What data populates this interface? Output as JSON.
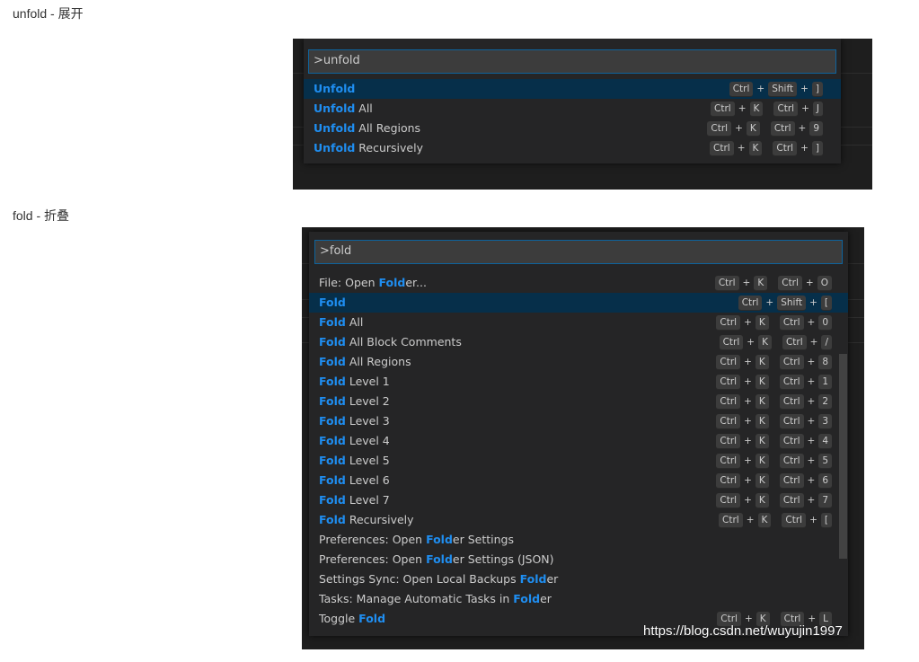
{
  "section1": {
    "caption": "unfold - 展开",
    "input_value": ">unfold",
    "items": [
      {
        "hl": "Unfold",
        "rest": "",
        "keys": [
          [
            "Ctrl",
            "Shift",
            "]"
          ]
        ],
        "selected": true
      },
      {
        "hl": "Unfold",
        "rest": " All",
        "keys": [
          [
            "Ctrl",
            "K"
          ],
          [
            "Ctrl",
            "J"
          ]
        ]
      },
      {
        "hl": "Unfold",
        "rest": " All Regions",
        "keys": [
          [
            "Ctrl",
            "K"
          ],
          [
            "Ctrl",
            "9"
          ]
        ]
      },
      {
        "hl": "Unfold",
        "rest": " Recursively",
        "keys": [
          [
            "Ctrl",
            "K"
          ],
          [
            "Ctrl",
            "]"
          ]
        ]
      }
    ]
  },
  "section2": {
    "caption": "fold - 折叠",
    "input_value": ">fold",
    "items": [
      {
        "pre": "File: Open ",
        "hl": "Fold",
        "rest": "er...",
        "keys": [
          [
            "Ctrl",
            "K"
          ],
          [
            "Ctrl",
            "O"
          ]
        ]
      },
      {
        "pre": "",
        "hl": "Fold",
        "rest": "",
        "keys": [
          [
            "Ctrl",
            "Shift",
            "["
          ]
        ],
        "selected": true
      },
      {
        "pre": "",
        "hl": "Fold",
        "rest": " All",
        "keys": [
          [
            "Ctrl",
            "K"
          ],
          [
            "Ctrl",
            "0"
          ]
        ]
      },
      {
        "pre": "",
        "hl": "Fold",
        "rest": " All Block Comments",
        "keys": [
          [
            "Ctrl",
            "K"
          ],
          [
            "Ctrl",
            "/"
          ]
        ]
      },
      {
        "pre": "",
        "hl": "Fold",
        "rest": " All Regions",
        "keys": [
          [
            "Ctrl",
            "K"
          ],
          [
            "Ctrl",
            "8"
          ]
        ]
      },
      {
        "pre": "",
        "hl": "Fold",
        "rest": " Level 1",
        "keys": [
          [
            "Ctrl",
            "K"
          ],
          [
            "Ctrl",
            "1"
          ]
        ]
      },
      {
        "pre": "",
        "hl": "Fold",
        "rest": " Level 2",
        "keys": [
          [
            "Ctrl",
            "K"
          ],
          [
            "Ctrl",
            "2"
          ]
        ]
      },
      {
        "pre": "",
        "hl": "Fold",
        "rest": " Level 3",
        "keys": [
          [
            "Ctrl",
            "K"
          ],
          [
            "Ctrl",
            "3"
          ]
        ]
      },
      {
        "pre": "",
        "hl": "Fold",
        "rest": " Level 4",
        "keys": [
          [
            "Ctrl",
            "K"
          ],
          [
            "Ctrl",
            "4"
          ]
        ]
      },
      {
        "pre": "",
        "hl": "Fold",
        "rest": " Level 5",
        "keys": [
          [
            "Ctrl",
            "K"
          ],
          [
            "Ctrl",
            "5"
          ]
        ]
      },
      {
        "pre": "",
        "hl": "Fold",
        "rest": " Level 6",
        "keys": [
          [
            "Ctrl",
            "K"
          ],
          [
            "Ctrl",
            "6"
          ]
        ]
      },
      {
        "pre": "",
        "hl": "Fold",
        "rest": " Level 7",
        "keys": [
          [
            "Ctrl",
            "K"
          ],
          [
            "Ctrl",
            "7"
          ]
        ]
      },
      {
        "pre": "",
        "hl": "Fold",
        "rest": " Recursively",
        "keys": [
          [
            "Ctrl",
            "K"
          ],
          [
            "Ctrl",
            "["
          ]
        ]
      },
      {
        "pre": "Preferences: Open ",
        "hl": "Fold",
        "rest": "er Settings",
        "keys": []
      },
      {
        "pre": "Preferences: Open ",
        "hl": "Fold",
        "rest": "er Settings (JSON)",
        "keys": []
      },
      {
        "pre": "Settings Sync: Open Local Backups ",
        "hl": "Fold",
        "rest": "er",
        "keys": []
      },
      {
        "pre": "Tasks: Manage Automatic Tasks in ",
        "hl": "Fold",
        "rest": "er",
        "keys": []
      },
      {
        "pre": "Toggle ",
        "hl": "Fold",
        "rest": "",
        "keys": [
          [
            "Ctrl",
            "K"
          ],
          [
            "Ctrl",
            "L"
          ]
        ]
      }
    ]
  },
  "watermark": "https://blog.csdn.net/wuyujin1997",
  "colors": {
    "highlight": "#1f8ef1",
    "selected_row": "#062f4a",
    "palette_bg": "#252526",
    "input_border": "#0e639c"
  }
}
